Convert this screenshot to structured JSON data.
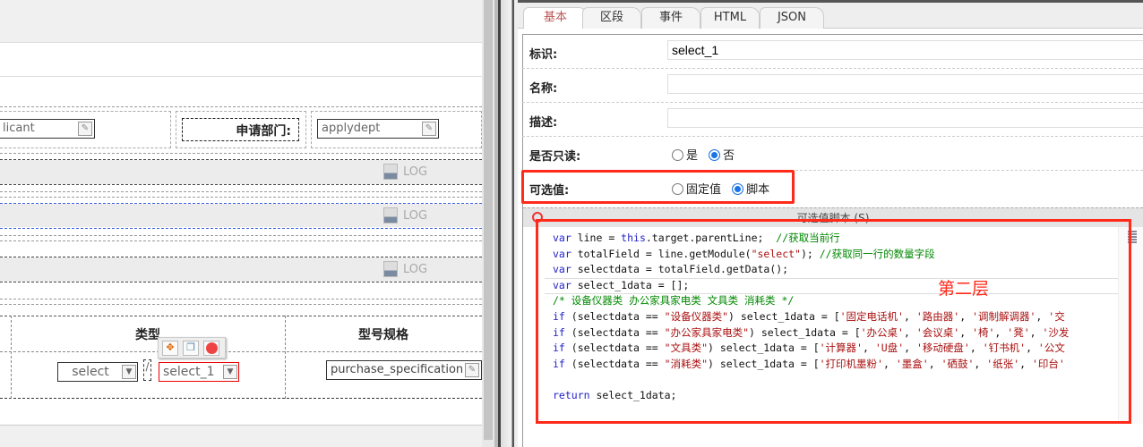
{
  "form": {
    "applicant_field": "licant",
    "dept_label": "申请部门:",
    "dept_field": "applydept",
    "log_label": "LOG",
    "col_type": "类型",
    "col_spec": "型号规格",
    "select_field": "select",
    "separator": "/",
    "select1_field": "select_1",
    "spec_field": "purchase_specification"
  },
  "panel": {
    "tabs": [
      "基本",
      "区段",
      "事件",
      "HTML",
      "JSON"
    ],
    "id_label": "标识:",
    "id_value": "select_1",
    "name_label": "名称:",
    "name_value": "",
    "desc_label": "描述:",
    "desc_value": "",
    "readonly_label": "是否只读:",
    "readonly_yes": "是",
    "readonly_no": "否",
    "options_label": "可选值:",
    "options_fixed": "固定值",
    "options_script": "脚本",
    "script_header": "可选值脚本 (S)",
    "annotation": "第二层"
  },
  "code": {
    "lines": [
      [
        [
          "kw",
          "var"
        ],
        [
          "pl",
          " line = "
        ],
        [
          "kw",
          "this"
        ],
        [
          "pl",
          ".target.parentLine;  "
        ],
        [
          "cm",
          "//获取当前行"
        ]
      ],
      [
        [
          "kw",
          "var"
        ],
        [
          "pl",
          " totalField = line.getModule("
        ],
        [
          "str",
          "\"select\""
        ],
        [
          "pl",
          "); "
        ],
        [
          "cm",
          "//获取同一行的数量字段"
        ]
      ],
      [
        [
          "kw",
          "var"
        ],
        [
          "pl",
          " selectdata = totalField.getData();"
        ]
      ],
      [
        [
          "kw",
          "var"
        ],
        [
          "pl",
          " select_1data = [];"
        ]
      ],
      [
        [
          "cm",
          "/* 设备仪器类 办公家具家电类 文具类 消耗类 */"
        ]
      ],
      [
        [
          "kw",
          "if"
        ],
        [
          "pl",
          " (selectdata == "
        ],
        [
          "str",
          "\"设备仪器类\""
        ],
        [
          "pl",
          ") select_1data = ["
        ],
        [
          "str",
          "'固定电话机'"
        ],
        [
          "pl",
          ", "
        ],
        [
          "str",
          "'路由器'"
        ],
        [
          "pl",
          ", "
        ],
        [
          "str",
          "'调制解调器'"
        ],
        [
          "pl",
          ", "
        ],
        [
          "str",
          "'交"
        ]
      ],
      [
        [
          "kw",
          "if"
        ],
        [
          "pl",
          " (selectdata == "
        ],
        [
          "str",
          "\"办公家具家电类\""
        ],
        [
          "pl",
          ") select_1data = ["
        ],
        [
          "str",
          "'办公桌'"
        ],
        [
          "pl",
          ", "
        ],
        [
          "str",
          "'会议桌'"
        ],
        [
          "pl",
          ", "
        ],
        [
          "str",
          "'椅'"
        ],
        [
          "pl",
          ", "
        ],
        [
          "str",
          "'凳'"
        ],
        [
          "pl",
          ", "
        ],
        [
          "str",
          "'沙发"
        ]
      ],
      [
        [
          "kw",
          "if"
        ],
        [
          "pl",
          " (selectdata == "
        ],
        [
          "str",
          "\"文具类\""
        ],
        [
          "pl",
          ") select_1data = ["
        ],
        [
          "str",
          "'计算器'"
        ],
        [
          "pl",
          ", "
        ],
        [
          "str",
          "'U盘'"
        ],
        [
          "pl",
          ", "
        ],
        [
          "str",
          "'移动硬盘'"
        ],
        [
          "pl",
          ", "
        ],
        [
          "str",
          "'钉书机'"
        ],
        [
          "pl",
          ", "
        ],
        [
          "str",
          "'公文"
        ]
      ],
      [
        [
          "kw",
          "if"
        ],
        [
          "pl",
          " (selectdata == "
        ],
        [
          "str",
          "\"消耗类\""
        ],
        [
          "pl",
          ") select_1data = ["
        ],
        [
          "str",
          "'打印机墨粉'"
        ],
        [
          "pl",
          ", "
        ],
        [
          "str",
          "'墨盒'"
        ],
        [
          "pl",
          ", "
        ],
        [
          "str",
          "'硒鼓'"
        ],
        [
          "pl",
          ", "
        ],
        [
          "str",
          "'纸张'"
        ],
        [
          "pl",
          ", "
        ],
        [
          "str",
          "'印台'"
        ]
      ],
      [],
      [
        [
          "kw",
          "return"
        ],
        [
          "pl",
          " select_1data;"
        ]
      ]
    ]
  },
  "colors": {
    "highlight": "#ff2a1a",
    "accent": "#1a73e8"
  }
}
